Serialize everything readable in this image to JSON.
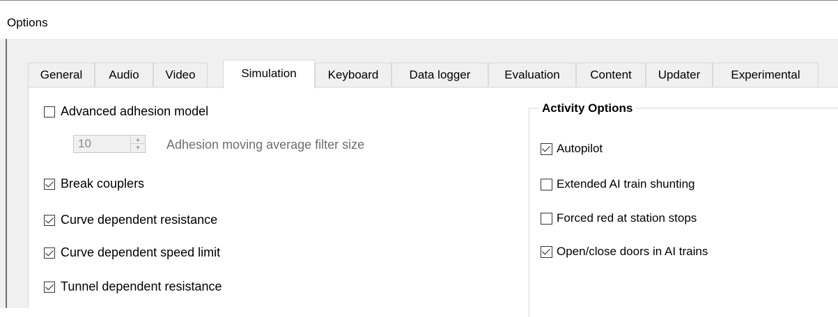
{
  "window": {
    "title": "Options"
  },
  "tabs": [
    {
      "label": "General"
    },
    {
      "label": "Audio"
    },
    {
      "label": "Video"
    },
    {
      "label": "Simulation",
      "active": true
    },
    {
      "label": "Keyboard"
    },
    {
      "label": "Data logger"
    },
    {
      "label": "Evaluation"
    },
    {
      "label": "Content"
    },
    {
      "label": "Updater"
    },
    {
      "label": "Experimental"
    }
  ],
  "simulation": {
    "advanced_adhesion": {
      "label": "Advanced adhesion model",
      "checked": false
    },
    "adhesion_filter": {
      "value": "10",
      "label": "Adhesion moving average filter size",
      "enabled": false
    },
    "break_couplers": {
      "label": "Break couplers",
      "checked": true
    },
    "curve_resistance": {
      "label": "Curve dependent resistance",
      "checked": true
    },
    "curve_speed_limit": {
      "label": "Curve dependent speed limit",
      "checked": true
    },
    "tunnel_resistance": {
      "label": "Tunnel dependent resistance",
      "checked": true
    }
  },
  "activity_options": {
    "title": "Activity Options",
    "autopilot": {
      "label": "Autopilot",
      "checked": true
    },
    "extended_ai_shunting": {
      "label": "Extended AI train shunting",
      "checked": false
    },
    "forced_red": {
      "label": "Forced red at station stops",
      "checked": false
    },
    "open_close_doors": {
      "label": "Open/close doors in AI trains",
      "checked": true
    }
  },
  "icons": {
    "spin_up": "chevron-up-icon",
    "spin_down": "chevron-down-icon",
    "check": "checkmark-icon"
  }
}
